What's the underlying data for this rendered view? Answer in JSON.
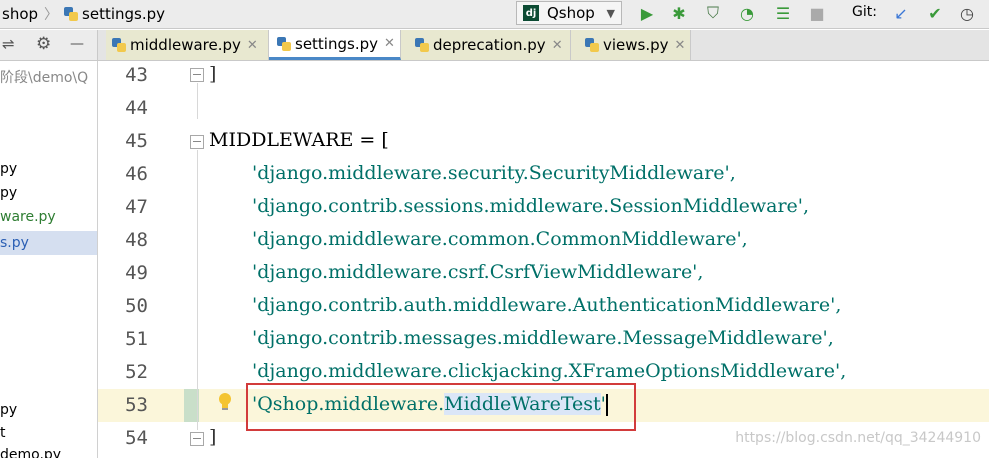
{
  "topbar": {
    "breadcrumb": [
      "shop",
      "settings.py"
    ],
    "run_config": "Qshop",
    "git_label": "Git:"
  },
  "tabs": [
    {
      "label": "middleware.py"
    },
    {
      "label": "settings.py"
    },
    {
      "label": "deprecation.py"
    },
    {
      "label": "views.py"
    }
  ],
  "sidebar": {
    "path": "阶段\\demo\\Q",
    "items": [
      "py",
      "py",
      "ware.py",
      "s.py",
      "py",
      "t",
      "demo.py"
    ]
  },
  "editor": {
    "lines": [
      {
        "no": "43",
        "text": "]"
      },
      {
        "no": "44",
        "text": ""
      },
      {
        "no": "45",
        "text": "MIDDLEWARE = ["
      },
      {
        "no": "46",
        "text": "'django.middleware.security.SecurityMiddleware',"
      },
      {
        "no": "47",
        "text": "'django.contrib.sessions.middleware.SessionMiddleware',"
      },
      {
        "no": "48",
        "text": "'django.middleware.common.CommonMiddleware',"
      },
      {
        "no": "49",
        "text": "'django.middleware.csrf.CsrfViewMiddleware',"
      },
      {
        "no": "50",
        "text": "'django.contrib.auth.middleware.AuthenticationMiddleware',"
      },
      {
        "no": "51",
        "text": "'django.contrib.messages.middleware.MessageMiddleware',"
      },
      {
        "no": "52",
        "text": "'django.middleware.clickjacking.XFrameOptionsMiddleware',"
      },
      {
        "no": "53",
        "text_a": "'Qshop.middleware.",
        "text_b": "MiddleWareTest",
        "text_c": "'"
      },
      {
        "no": "54",
        "text": "]"
      }
    ]
  },
  "watermark": "https://blog.csdn.net/qq_34244910",
  "colors": {
    "string": "#007068",
    "highlight_box": "#d23b3b",
    "current_line": "#fbf6da"
  }
}
